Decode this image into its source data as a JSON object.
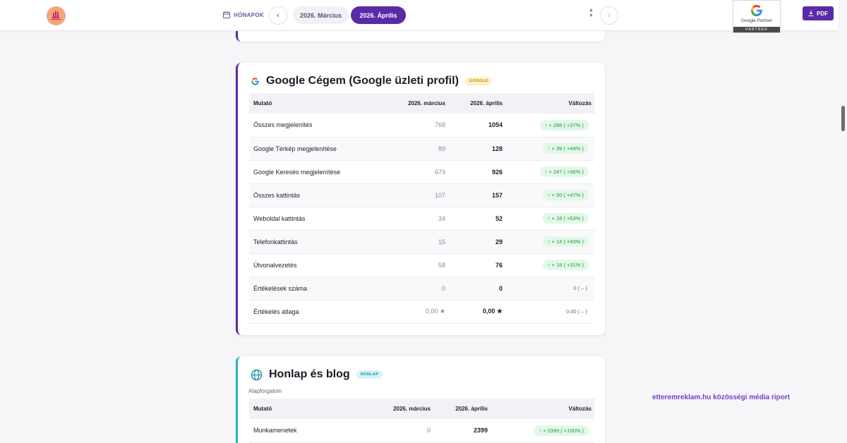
{
  "header": {
    "months_label": "HÓNAPOK",
    "prev_month": "2026. Március",
    "active_month": "2026. Április",
    "prev_arrow": "‹",
    "next_arrow": "›",
    "stepper_up": "▲",
    "stepper_down": "▼",
    "partner_badge": {
      "name": "Google Partner",
      "bar": "PARTNER"
    },
    "pdf_label": "PDF"
  },
  "colors": {
    "accent": "#5b2aa6",
    "web_accent": "#24b6c9",
    "positive": "#1d9a3f",
    "brand_text": "#7a3dc8"
  },
  "google_card": {
    "title": "Google Cégem (Google üzleti profil)",
    "badge": "GOOGLE",
    "icon": "google-g-icon",
    "columns": {
      "metric": "Mutató",
      "prev": "2026. március",
      "curr": "2026. április",
      "change": "Változás"
    },
    "rows": [
      {
        "metric": "Összes megjelenítés",
        "prev": "768",
        "curr": "1054",
        "change": "↑ + 286 ( +37% )",
        "trend": "up"
      },
      {
        "metric": "Google Térkép megjelenítése",
        "prev": "89",
        "curr": "128",
        "change": "↑ + 39 ( +44% )",
        "trend": "up"
      },
      {
        "metric": "Google Keresés megjelenítése",
        "prev": "679",
        "curr": "926",
        "change": "↑ + 247 ( +36% )",
        "trend": "up"
      },
      {
        "metric": "Összes kattintás",
        "prev": "107",
        "curr": "157",
        "change": "↑ + 50 ( +47% )",
        "trend": "up"
      },
      {
        "metric": "Weboldal kattintás",
        "prev": "34",
        "curr": "52",
        "change": "↑ + 18 ( +53% )",
        "trend": "up"
      },
      {
        "metric": "Telefonkattintás",
        "prev": "15",
        "curr": "29",
        "change": "↑ + 14 ( +93% )",
        "trend": "up"
      },
      {
        "metric": "Útvonalvezetés",
        "prev": "58",
        "curr": "76",
        "change": "↑ + 18 ( +31% )",
        "trend": "up"
      },
      {
        "metric": "Értékelések száma",
        "prev": "0",
        "curr": "0",
        "change": "0 ( – )",
        "trend": "neutral"
      },
      {
        "metric": "Értékelés átlaga",
        "prev": "0,00 ★",
        "curr": "0,00 ★",
        "change": "0,00 ( – )",
        "trend": "neutral"
      }
    ]
  },
  "web_card": {
    "title": "Honlap és blog",
    "badge": "HONLAP",
    "icon": "globe-icon",
    "subtitle": "Alapforgalom",
    "columns": {
      "metric": "Mutató",
      "prev": "2026. március",
      "curr": "2026. április",
      "change": "Változás"
    },
    "rows": [
      {
        "metric": "Munkamenetek",
        "prev": "0",
        "curr": "2399",
        "change": "↑ + 2399 ( +100% )",
        "trend": "up"
      }
    ]
  },
  "footer_brand": "etteremreklam.hu közösségi média riport"
}
